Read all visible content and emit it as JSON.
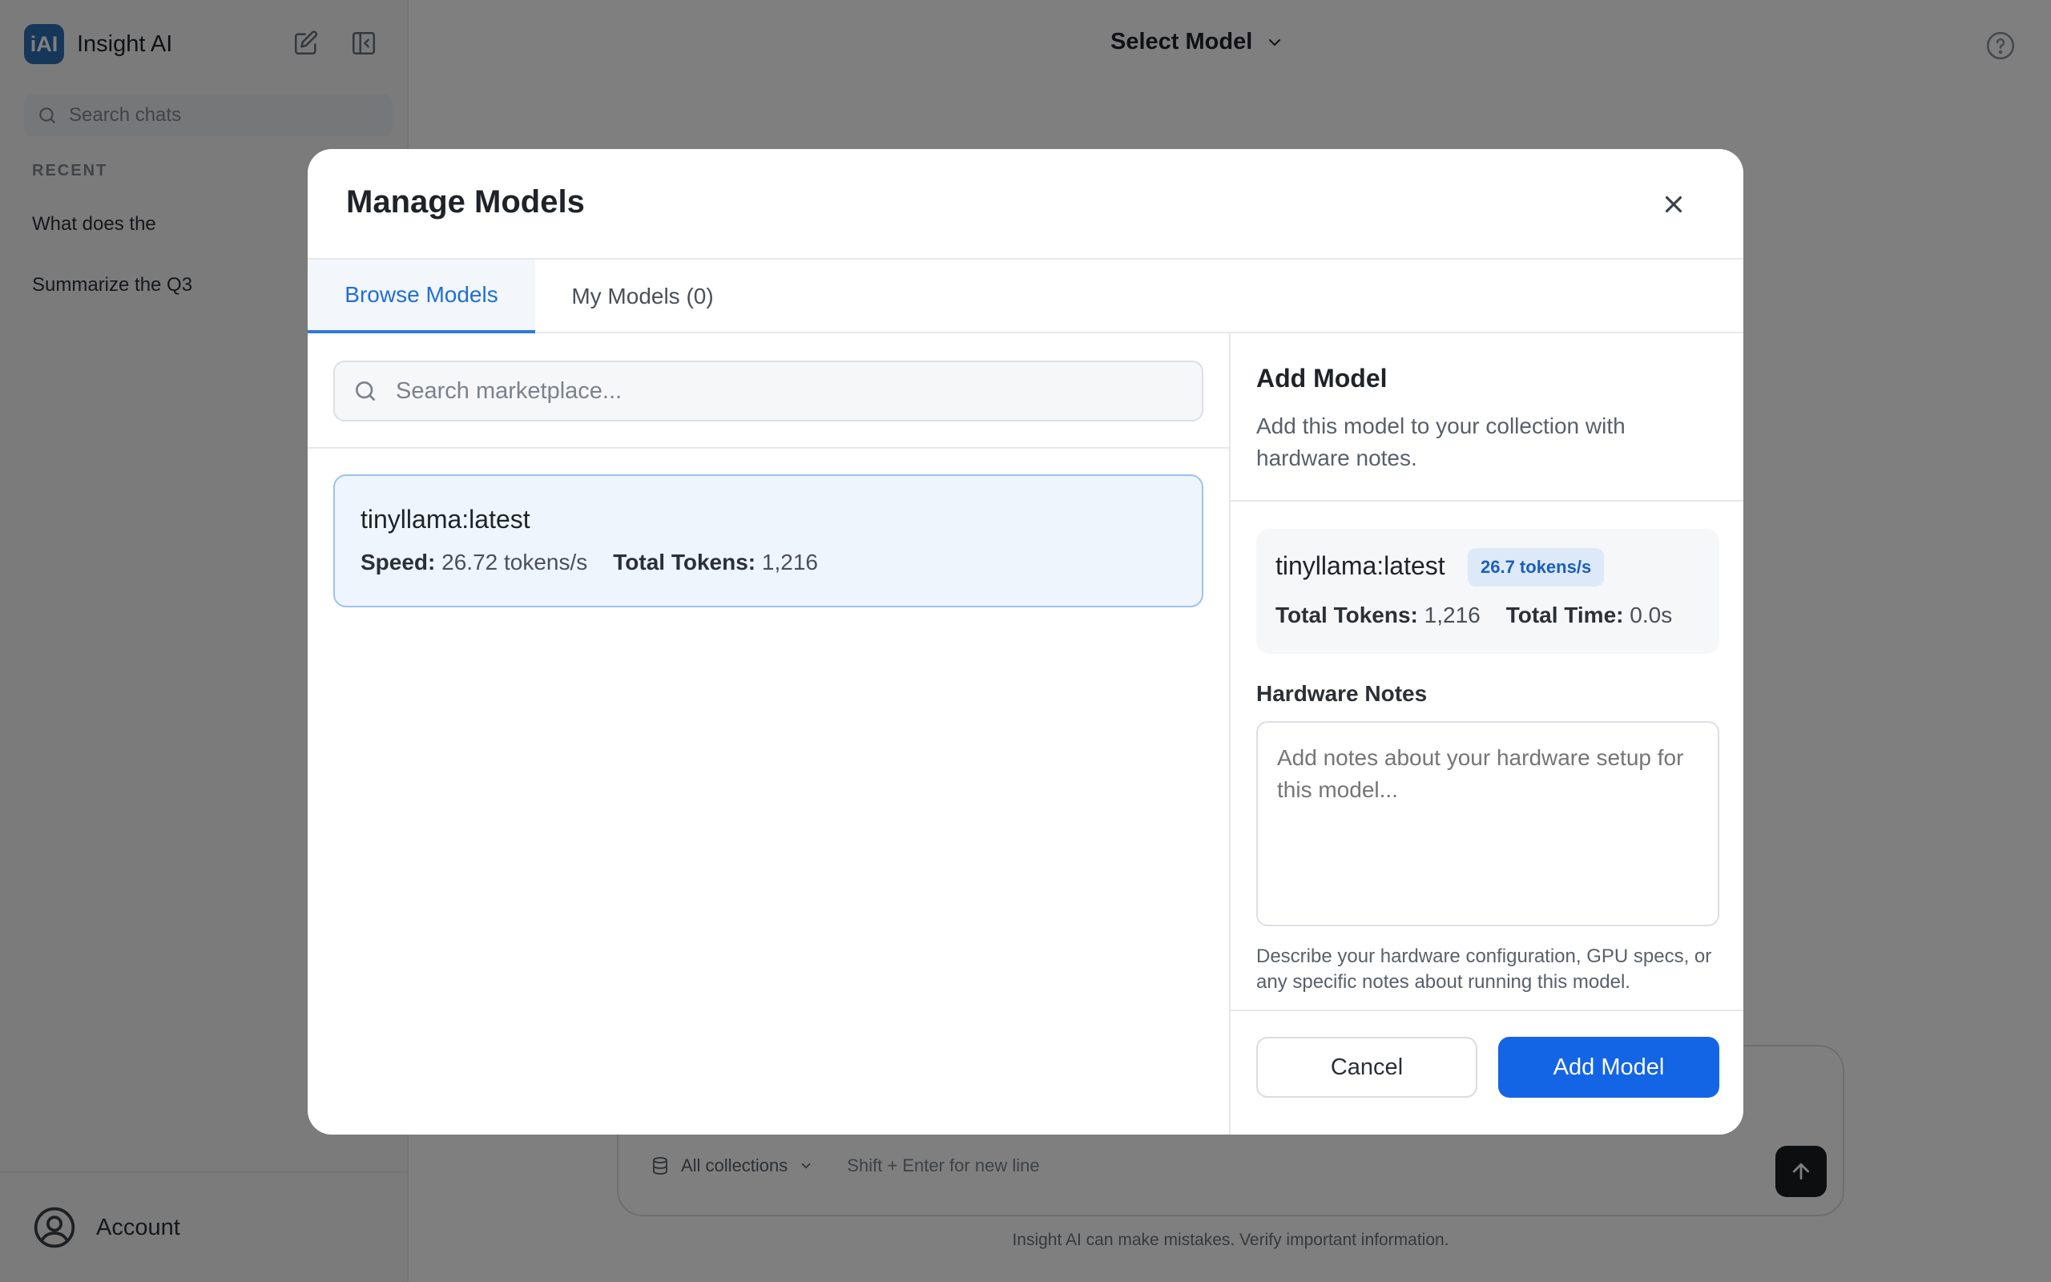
{
  "app": {
    "name": "Insight AI",
    "logo_text": "iAI"
  },
  "sidebar": {
    "search_placeholder": "Search chats",
    "recent_label": "RECENT",
    "chats": [
      "What does the",
      "Summarize the Q3"
    ],
    "account_label": "Account"
  },
  "header": {
    "model_select_label": "Select Model"
  },
  "composer": {
    "collections_label": "All collections",
    "hint": "Shift + Enter for new line",
    "disclaimer": "Insight AI can make mistakes. Verify important information."
  },
  "modal": {
    "title": "Manage Models",
    "tabs": [
      {
        "label": "Browse Models",
        "active": true
      },
      {
        "label": "My Models (0)",
        "active": false
      }
    ],
    "search_placeholder": "Search marketplace...",
    "models": [
      {
        "name": "tinyllama:latest",
        "speed_label": "Speed:",
        "speed_value": "26.72 tokens/s",
        "tokens_label": "Total Tokens:",
        "tokens_value": "1,216"
      }
    ],
    "add_panel": {
      "title": "Add Model",
      "description": "Add this model to your collection with hardware notes.",
      "summary": {
        "name": "tinyllama:latest",
        "badge": "26.7 tokens/s",
        "tokens_label": "Total Tokens:",
        "tokens_value": "1,216",
        "time_label": "Total Time:",
        "time_value": "0.0s"
      },
      "hardware_label": "Hardware Notes",
      "hardware_placeholder": "Add notes about your hardware setup for this model...",
      "hardware_help": "Describe your hardware configuration, GPU specs, or any specific notes about running this model.",
      "cancel_label": "Cancel",
      "add_label": "Add Model"
    }
  },
  "colors": {
    "accent": "#1464e6",
    "badge_bg": "#dde9f8",
    "selected_card_bg": "#eef5fd"
  }
}
